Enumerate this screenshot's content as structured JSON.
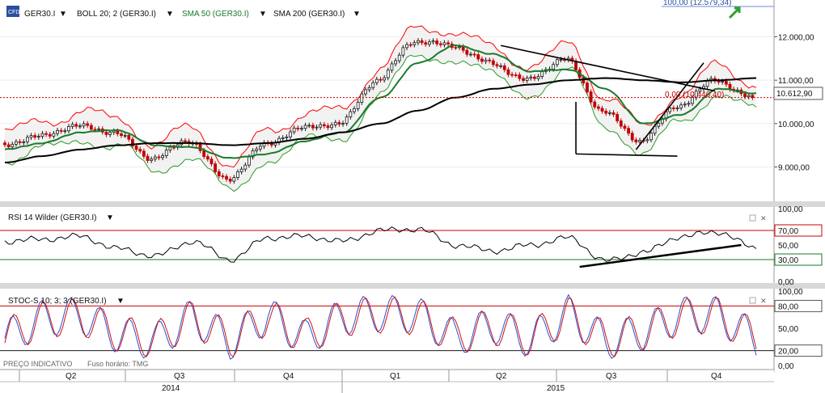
{
  "price_panel": {
    "symbol_label": "GER30.I",
    "indicators": [
      {
        "label": "BOLL 20; 2 (GER30.I)",
        "color": "#000000"
      },
      {
        "label": "SMA 50 (GER30.I)",
        "color": "#1a7a2a"
      },
      {
        "label": "SMA 200 (GER30.I)",
        "color": "#000000"
      }
    ],
    "top_readout": "100,00 (12.579,34)",
    "current_price_label": "10.612,90",
    "fib_label": "0,00 (10.446,40)"
  },
  "rsi_panel": {
    "title": "RSI 14 Wilder (GER30.I)"
  },
  "stoch_panel": {
    "title": "STOC-S 10; 3; 3 (GER30.I)"
  },
  "footer": {
    "price_type": "PREÇO INDICATIVO",
    "timezone": "Fuso horário: TMG"
  },
  "colors": {
    "up_candle": "#1a1a1a",
    "down_candle": "#c00000",
    "boll": "#ff0000",
    "sma50": "#1a7a2a",
    "sma200": "#000000",
    "rsi_line": "#000000",
    "stoch_k": "#2a4fd0",
    "stoch_d": "#d01010",
    "ref_line": "#cc0000",
    "ref_line_low": "#1a7a2a"
  },
  "chart_data": [
    {
      "type": "line",
      "name": "price",
      "x": [
        "2014-04",
        "2014-05",
        "2014-06",
        "2014-07",
        "2014-08",
        "2014-09",
        "2014-10",
        "2014-11",
        "2014-12",
        "2015-01",
        "2015-02",
        "2015-03",
        "2015-04",
        "2015-05",
        "2015-06",
        "2015-07",
        "2015-08",
        "2015-09",
        "2015-10",
        "2015-11",
        "2015-12"
      ],
      "series": [
        {
          "name": "GER30.I",
          "values": [
            9500,
            9700,
            9950,
            9800,
            9200,
            9600,
            8700,
            9500,
            9900,
            10000,
            11000,
            11900,
            11800,
            11400,
            11000,
            11500,
            10300,
            9600,
            10400,
            11000,
            10600
          ]
        },
        {
          "name": "SMA 50",
          "values": [
            9400,
            9550,
            9800,
            9850,
            9500,
            9450,
            9200,
            9300,
            9600,
            9800,
            10600,
            11400,
            11800,
            11600,
            11200,
            11250,
            10800,
            10000,
            10200,
            10800,
            10700
          ]
        },
        {
          "name": "SMA 200",
          "values": [
            9100,
            9250,
            9400,
            9500,
            9550,
            9550,
            9500,
            9550,
            9650,
            9800,
            10000,
            10300,
            10600,
            10800,
            10900,
            11000,
            11050,
            11000,
            10950,
            11000,
            11050
          ]
        }
      ],
      "ylim": [
        8300,
        12700
      ],
      "yticks": [
        9000,
        10000,
        11000,
        12000
      ],
      "ytick_labels": [
        "9.000,00",
        "10.000,00",
        "11.000,00",
        "12.000,00"
      ]
    },
    {
      "type": "line",
      "name": "rsi",
      "x": [
        "2014-04",
        "2014-05",
        "2014-06",
        "2014-07",
        "2014-08",
        "2014-09",
        "2014-10",
        "2014-11",
        "2014-12",
        "2015-01",
        "2015-02",
        "2015-03",
        "2015-04",
        "2015-05",
        "2015-06",
        "2015-07",
        "2015-08",
        "2015-09",
        "2015-10",
        "2015-11",
        "2015-12"
      ],
      "series": [
        {
          "name": "RSI",
          "values": [
            55,
            58,
            62,
            45,
            35,
            55,
            30,
            60,
            62,
            55,
            70,
            72,
            50,
            42,
            50,
            60,
            28,
            40,
            62,
            68,
            45
          ]
        }
      ],
      "ylim": [
        0,
        100
      ],
      "yticks": [
        0,
        30,
        50,
        70,
        100
      ],
      "ytick_labels": [
        "0,00",
        "30,00",
        "50,00",
        "70,00",
        "100,00"
      ]
    },
    {
      "type": "line",
      "name": "stochastic",
      "x": [
        "2014-04",
        "2014-05",
        "2014-06",
        "2014-07",
        "2014-08",
        "2014-09",
        "2014-10",
        "2014-11",
        "2014-12",
        "2015-01",
        "2015-02",
        "2015-03",
        "2015-04",
        "2015-05",
        "2015-06",
        "2015-07",
        "2015-08",
        "2015-09",
        "2015-10",
        "2015-11",
        "2015-12"
      ],
      "series": [
        {
          "name": "%K",
          "values": [
            20,
            80,
            90,
            30,
            10,
            85,
            10,
            90,
            20,
            85,
            95,
            90,
            20,
            60,
            15,
            95,
            10,
            40,
            90,
            90,
            15
          ]
        },
        {
          "name": "%D",
          "values": [
            25,
            75,
            85,
            35,
            15,
            80,
            15,
            85,
            25,
            80,
            90,
            85,
            25,
            55,
            20,
            90,
            15,
            40,
            85,
            88,
            20
          ]
        }
      ],
      "ylim": [
        0,
        100
      ],
      "yticks": [
        0,
        20,
        50,
        80,
        100
      ],
      "ytick_labels": [
        "0,00",
        "20,00",
        "50,00",
        "80,00",
        "100,00"
      ]
    }
  ],
  "time_axis": {
    "quarters": [
      "Q2",
      "Q3",
      "Q4",
      "Q1",
      "Q2",
      "Q3",
      "Q4"
    ],
    "years": [
      "2014",
      "2015"
    ]
  }
}
